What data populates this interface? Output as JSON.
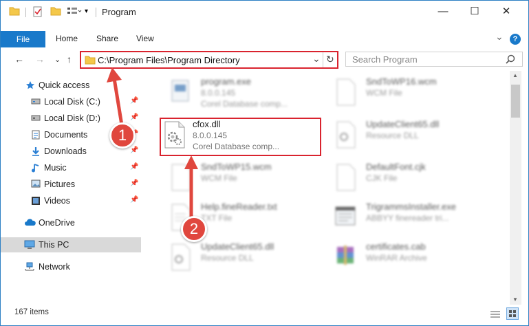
{
  "window": {
    "title": "Program",
    "minimize": "—",
    "maximize": "☐",
    "close": "✕"
  },
  "ribbon": {
    "file": "File",
    "tabs": [
      "Home",
      "Share",
      "View"
    ],
    "expand": "⌄",
    "help": "?"
  },
  "address": {
    "path": "C:\\Program Files\\Program Directory",
    "dropdown": "⌄",
    "refresh": "↻"
  },
  "search": {
    "placeholder": "Search Program",
    "icon": "search-icon"
  },
  "nav": {
    "back": "←",
    "forward": "→",
    "recent": "⌄",
    "up": "↑"
  },
  "sidebar": {
    "quick_access": "Quick access",
    "items": [
      {
        "label": "Local Disk (C:)",
        "icon": "drive-icon",
        "pinned": true
      },
      {
        "label": "Local Disk (D:)",
        "icon": "drive-icon",
        "pinned": true
      },
      {
        "label": "Documents",
        "icon": "documents-icon",
        "pinned": true
      },
      {
        "label": "Downloads",
        "icon": "downloads-icon",
        "pinned": true
      },
      {
        "label": "Music",
        "icon": "music-icon",
        "pinned": true
      },
      {
        "label": "Pictures",
        "icon": "pictures-icon",
        "pinned": true
      },
      {
        "label": "Videos",
        "icon": "videos-icon",
        "pinned": true
      }
    ],
    "onedrive": "OneDrive",
    "this_pc": "This PC",
    "network": "Network",
    "pin_glyph": "📌"
  },
  "files": {
    "left": [
      {
        "name": "program.exe",
        "line1": "8.0.0.145",
        "line2": "Corel Database comp..."
      },
      {
        "name": "cfox.dll",
        "line1": "8.0.0.145",
        "line2": "Corel Database comp..."
      },
      {
        "name": "SndToWP15.wcm",
        "line1": "WCM File",
        "line2": ""
      },
      {
        "name": "Help.fineReader.txt",
        "line1": "TXT File",
        "line2": ""
      },
      {
        "name": "UpdateClient65.dll",
        "line1": "Resource DLL",
        "line2": ""
      }
    ],
    "right": [
      {
        "name": "SndToWP16.wcm",
        "line1": "WCM File",
        "line2": ""
      },
      {
        "name": "UpdateClient65.dll",
        "line1": "Resource DLL",
        "line2": ""
      },
      {
        "name": "DefaultFont.cjk",
        "line1": "CJK File",
        "line2": ""
      },
      {
        "name": "TrigrammsInstaller.exe",
        "line1": "ABBYY finereader tri...",
        "line2": ""
      },
      {
        "name": "certificates.cab",
        "line1": "WinRAR Archive",
        "line2": ""
      }
    ]
  },
  "status": {
    "count": "167 items"
  },
  "annotations": {
    "step1": "1",
    "step2": "2",
    "color": "#e0473e"
  },
  "colors": {
    "accent": "#1979ca",
    "highlight": "#d9232e",
    "selection": "#d9d9d9"
  }
}
